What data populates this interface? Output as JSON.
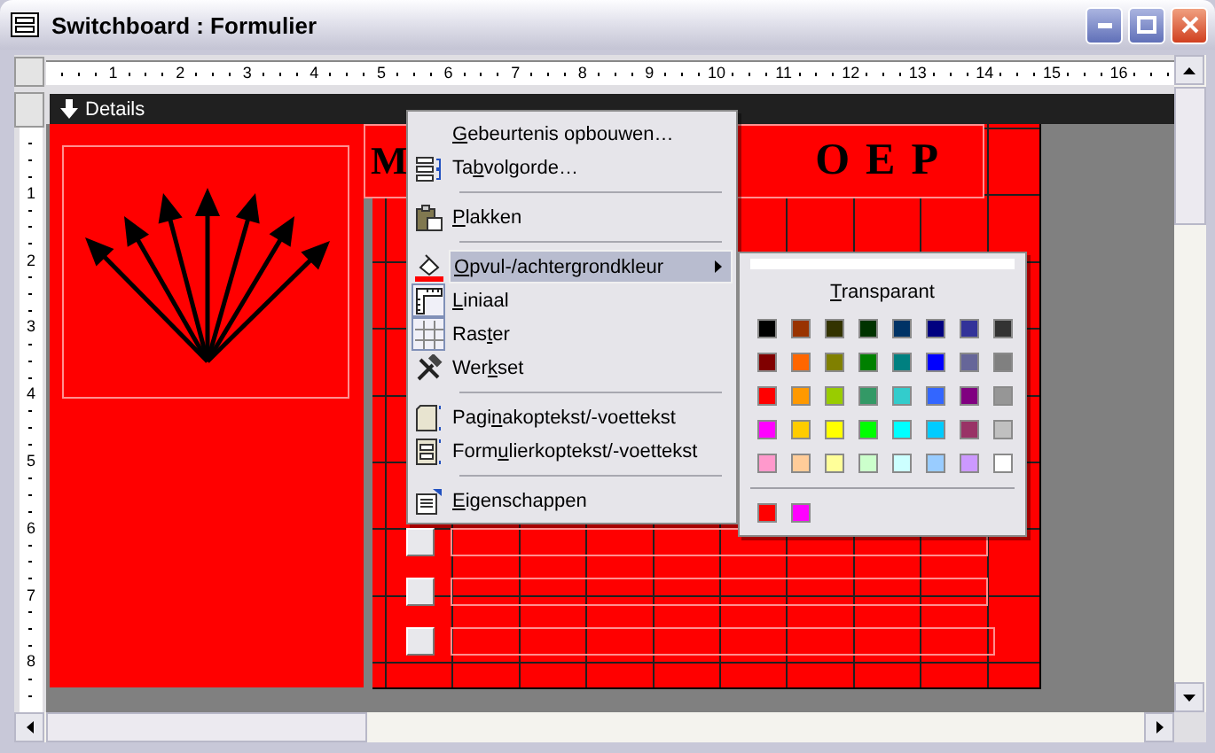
{
  "window": {
    "title": "Switchboard : Formulier"
  },
  "ruler_horizontal": [
    "1",
    "2",
    "3",
    "4",
    "5",
    "6",
    "7",
    "8",
    "9",
    "10",
    "11",
    "12",
    "13",
    "14",
    "15",
    "16"
  ],
  "ruler_vertical": [
    "1",
    "2",
    "3",
    "4",
    "5",
    "6",
    "7",
    "8"
  ],
  "section": {
    "title": "Details"
  },
  "form": {
    "title_label_visible_parts": [
      "M",
      "OEP"
    ]
  },
  "context_menu": {
    "items": [
      {
        "kind": "item",
        "key": "G",
        "post": "ebeurtenis opbouwen…",
        "selected": false,
        "checked": false,
        "has_submenu": false
      },
      {
        "kind": "item",
        "pre": "Ta",
        "key": "b",
        "post": "volgorde…",
        "selected": false,
        "checked": false,
        "has_submenu": false
      },
      {
        "kind": "separator"
      },
      {
        "kind": "item",
        "key": "P",
        "post": "lakken",
        "selected": false,
        "checked": false,
        "has_submenu": false
      },
      {
        "kind": "separator"
      },
      {
        "kind": "item",
        "key": "O",
        "post": "pvul-/achtergrondkleur",
        "selected": true,
        "checked": false,
        "has_submenu": true
      },
      {
        "kind": "item",
        "key": "L",
        "post": "iniaal",
        "selected": false,
        "checked": true,
        "has_submenu": false
      },
      {
        "kind": "item",
        "pre": "Ras",
        "key": "t",
        "post": "er",
        "selected": false,
        "checked": true,
        "has_submenu": false
      },
      {
        "kind": "item",
        "pre": "Wer",
        "key": "k",
        "post": "set",
        "selected": false,
        "checked": false,
        "has_submenu": false
      },
      {
        "kind": "separator"
      },
      {
        "kind": "item",
        "pre": "Pagi",
        "key": "n",
        "post": "akoptekst/-voettekst",
        "selected": false,
        "checked": false,
        "has_submenu": false
      },
      {
        "kind": "item",
        "pre": "Form",
        "key": "u",
        "post": "lierkoptekst/-voettekst",
        "selected": false,
        "checked": false,
        "has_submenu": false
      },
      {
        "kind": "separator"
      },
      {
        "kind": "item",
        "key": "E",
        "post": "igenschappen",
        "selected": false,
        "checked": false,
        "has_submenu": false
      }
    ]
  },
  "fill_color_submenu": {
    "transparent": {
      "key": "T",
      "post": "ransparant"
    },
    "colors": [
      {
        "color": "#000000"
      },
      {
        "color": "#993300"
      },
      {
        "color": "#333300"
      },
      {
        "color": "#003300"
      },
      {
        "color": "#003366"
      },
      {
        "color": "#000080"
      },
      {
        "color": "#333399"
      },
      {
        "color": "#333333"
      },
      {
        "color": "#800000"
      },
      {
        "color": "#ff6600"
      },
      {
        "color": "#808000"
      },
      {
        "color": "#008000"
      },
      {
        "color": "#008080"
      },
      {
        "color": "#0000ff"
      },
      {
        "color": "#666699"
      },
      {
        "color": "#808080"
      },
      {
        "color": "#ff0000"
      },
      {
        "color": "#ff9900"
      },
      {
        "color": "#99cc00"
      },
      {
        "color": "#339966"
      },
      {
        "color": "#33cccc"
      },
      {
        "color": "#3366ff"
      },
      {
        "color": "#800080"
      },
      {
        "color": "#969696"
      },
      {
        "color": "#ff00ff"
      },
      {
        "color": "#ffcc00"
      },
      {
        "color": "#ffff00"
      },
      {
        "color": "#00ff00"
      },
      {
        "color": "#00ffff"
      },
      {
        "color": "#00ccff"
      },
      {
        "color": "#993366"
      },
      {
        "color": "#c0c0c0"
      },
      {
        "color": "#ff99cc"
      },
      {
        "color": "#ffcc99"
      },
      {
        "color": "#ffff99"
      },
      {
        "color": "#ccffcc"
      },
      {
        "color": "#ccffff"
      },
      {
        "color": "#99ccff"
      },
      {
        "color": "#cc99ff"
      },
      {
        "color": "#ffffff"
      }
    ],
    "recent_colors": [
      {
        "color": "#ff0000"
      },
      {
        "color": "#ff00ff"
      }
    ]
  }
}
